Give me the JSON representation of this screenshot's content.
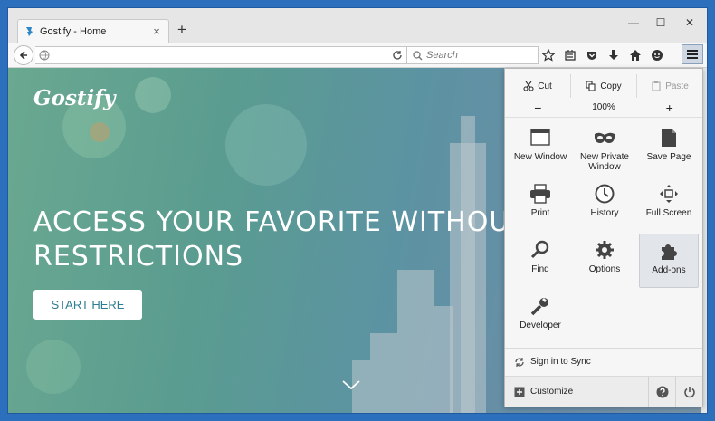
{
  "tab": {
    "title": "Gostify - Home",
    "close": "×",
    "new_tab": "+"
  },
  "window_controls": {
    "minimize": "—",
    "maximize": "☐",
    "close": "✕"
  },
  "search": {
    "placeholder": "Search"
  },
  "page": {
    "logo": "Gostify",
    "headline_line1": "ACCESS YOUR FAVORITE WITHOU",
    "headline_line2": "RESTRICTIONS",
    "cta": "START HERE"
  },
  "menu": {
    "edit": {
      "cut": "Cut",
      "copy": "Copy",
      "paste": "Paste"
    },
    "zoom": {
      "minus": "−",
      "level": "100%",
      "plus": "+"
    },
    "items": [
      {
        "label": "New Window",
        "icon": "new-window-icon"
      },
      {
        "label": "New Private Window",
        "icon": "mask-icon"
      },
      {
        "label": "Save Page",
        "icon": "page-icon"
      },
      {
        "label": "Print",
        "icon": "printer-icon"
      },
      {
        "label": "History",
        "icon": "clock-icon"
      },
      {
        "label": "Full Screen",
        "icon": "fullscreen-icon"
      },
      {
        "label": "Find",
        "icon": "magnifier-icon"
      },
      {
        "label": "Options",
        "icon": "gear-icon"
      },
      {
        "label": "Add-ons",
        "icon": "puzzle-icon"
      },
      {
        "label": "Developer",
        "icon": "wrench-icon"
      }
    ],
    "sync": "Sign in to Sync",
    "customize": "Customize"
  }
}
